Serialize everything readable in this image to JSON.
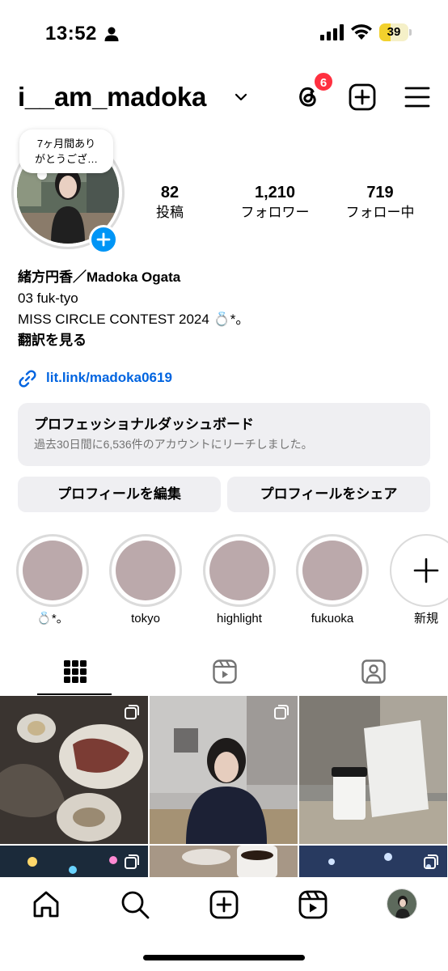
{
  "status_bar": {
    "time": "13:52",
    "battery": "39",
    "battery_level": 0.39
  },
  "header": {
    "username": "i__am_madoka",
    "threads_badge": "6"
  },
  "profile": {
    "note": "7ヶ月間あり\nがとうござ…",
    "stats": {
      "posts_value": "82",
      "posts_label": "投稿",
      "followers_value": "1,210",
      "followers_label": "フォロワー",
      "following_value": "719",
      "following_label": "フォロー中"
    },
    "bio": {
      "name": "緒方円香／Madoka Ogata",
      "line1": "03 fuk-tyo",
      "line2": "MISS CIRCLE CONTEST 2024 💍*。",
      "translate": "翻訳を見る"
    },
    "link": "lit.link/madoka0619"
  },
  "dashboard": {
    "title": "プロフェッショナルダッシュボード",
    "subtitle": "過去30日間に6,536件のアカウントにリーチしました。"
  },
  "buttons": {
    "edit": "プロフィールを編集",
    "share": "プロフィールをシェア"
  },
  "highlights": [
    {
      "label": "💍*。"
    },
    {
      "label": "tokyo"
    },
    {
      "label": "highlight"
    },
    {
      "label": "fukuoka"
    },
    {
      "label": "新規"
    }
  ],
  "tabs": [
    "grid-icon",
    "reels-icon",
    "tagged-icon"
  ],
  "bottom_nav": [
    "home-icon",
    "search-icon",
    "create-icon",
    "reels-icon",
    "profile-avatar"
  ],
  "colors": {
    "accent_blue": "#0095f6",
    "link_blue": "#0064e0",
    "badge_red": "#ff3040",
    "highlight_fill": "#bba9ab"
  }
}
